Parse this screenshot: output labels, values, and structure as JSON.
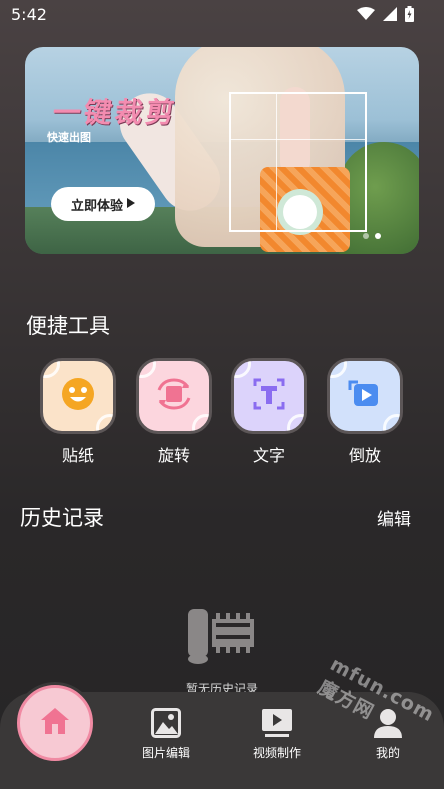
{
  "status_bar": {
    "time": "5:42"
  },
  "banner": {
    "headline": "一键裁剪",
    "subline": "快速出图",
    "cta_label": "立即体验"
  },
  "quick_tools": {
    "title": "便捷工具",
    "items": [
      {
        "label": "贴纸",
        "icon": "smiley-sticker-icon",
        "color": "#fbe3c9"
      },
      {
        "label": "旋转",
        "icon": "rotate-icon",
        "color": "#fcd6de"
      },
      {
        "label": "文字",
        "icon": "text-icon",
        "color": "#dcd3fb"
      },
      {
        "label": "倒放",
        "icon": "rewind-play-icon",
        "color": "#d2e1fb"
      }
    ]
  },
  "history": {
    "title": "历史记录",
    "edit_label": "编辑",
    "empty_text": "暂无历史记录"
  },
  "bottom_nav": {
    "items": [
      {
        "label": "图片编辑",
        "icon": "image-icon"
      },
      {
        "label": "视频制作",
        "icon": "video-play-icon"
      },
      {
        "label": "我的",
        "icon": "user-icon"
      }
    ]
  },
  "watermark": "mfun.com 魔方网",
  "colors": {
    "accent_pink": "#f08aa3",
    "home_fill": "#f7c9d3",
    "nav_bg": "#3a3838"
  }
}
